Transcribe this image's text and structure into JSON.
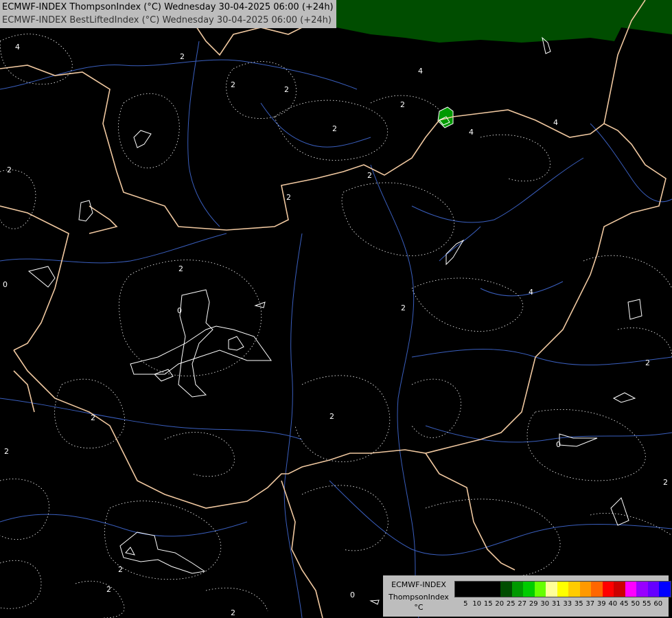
{
  "title": {
    "line1": "ECMWF-INDEX ThompsonIndex (°C) Wednesday 30-04-2025 06:00 (+24h)",
    "line2": "ECMWF-INDEX BestLiftedIndex (°C) Wednesday 30-04-2025 06:00 (+24h)"
  },
  "legend": {
    "model": "ECMWF-INDEX",
    "index": "ThompsonIndex",
    "unit": "°C",
    "ticks": [
      "5",
      "10",
      "15",
      "20",
      "25",
      "27",
      "29",
      "30",
      "31",
      "33",
      "35",
      "37",
      "39",
      "40",
      "45",
      "50",
      "55",
      "60"
    ],
    "colors": [
      "#000000",
      "#000000",
      "#000000",
      "#000000",
      "#004d00",
      "#009900",
      "#00cc00",
      "#66ff00",
      "#ffff99",
      "#ffff00",
      "#ffcc00",
      "#ff9900",
      "#ff6600",
      "#ff0000",
      "#cc0000",
      "#ff00ff",
      "#9900ff",
      "#6600ff",
      "#0000ff"
    ]
  },
  "contour_labels": [
    "4",
    "2",
    "2",
    "2",
    "2",
    "4",
    "2",
    "4",
    "4",
    "2",
    "2",
    "2",
    "0",
    "2",
    "4",
    "2",
    "2",
    "2",
    "2",
    "2",
    "0",
    "2",
    "2",
    "2",
    "0",
    "2",
    "0"
  ],
  "colors": {
    "background": "#000000",
    "border": "#f0c8a0",
    "river": "#3a5fbf",
    "contour": "#ffffff",
    "fill_dark_green": "#004d00",
    "fill_green": "#009900"
  }
}
